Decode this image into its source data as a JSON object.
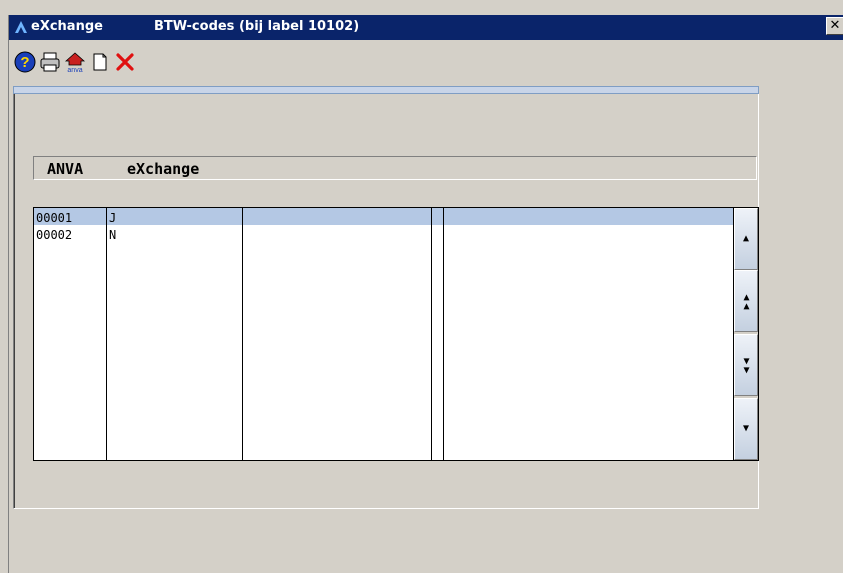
{
  "window": {
    "app_title": "eXchange",
    "subtitle": "BTW-codes (bij label 10102)",
    "close_glyph": "✕"
  },
  "toolbar": {
    "buttons": [
      {
        "name": "help",
        "icon": "help-icon"
      },
      {
        "name": "print",
        "icon": "printer-icon"
      },
      {
        "name": "anva",
        "icon": "anva-home-icon"
      },
      {
        "name": "new",
        "icon": "new-document-icon"
      },
      {
        "name": "delete",
        "icon": "delete-icon"
      }
    ]
  },
  "header": {
    "col1": "ANVA",
    "col2": "eXchange"
  },
  "grid": {
    "rows": [
      {
        "code": "00001",
        "value": "J",
        "selected": true
      },
      {
        "code": "00002",
        "value": "N",
        "selected": false
      }
    ]
  },
  "scrollbar": {
    "buttons": [
      {
        "name": "scroll-up",
        "glyph": "▲"
      },
      {
        "name": "page-up",
        "glyph": "▲▲"
      },
      {
        "name": "page-down",
        "glyph": "▼▼"
      },
      {
        "name": "scroll-down",
        "glyph": "▼"
      }
    ]
  },
  "colors": {
    "titlebar": "#0a246a",
    "selected_row": "#b4c8e4",
    "face": "#d4d0c8"
  }
}
